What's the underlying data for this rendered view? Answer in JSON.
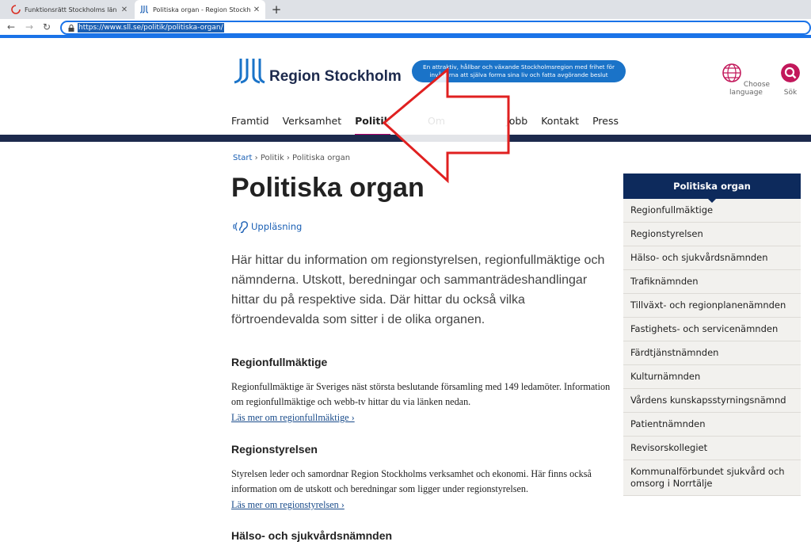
{
  "browser": {
    "tabs": [
      {
        "title": "Funktionsrätt Stockholms län – Et"
      },
      {
        "title": "Politiska organ - Region Stockholm"
      }
    ],
    "new_tab_label": "+",
    "url": "https://www.sll.se/politik/politiska-organ/"
  },
  "header": {
    "logo_text": "Region Stockholm",
    "tagline": "En attraktiv, hållbar och växande Stockholmsregion med frihet för invånarna att själva forma sina liv och fatta avgörande beslut",
    "language_label": "Choose language",
    "search_label": "Sök"
  },
  "nav": {
    "items": [
      {
        "label": "Framtid"
      },
      {
        "label": "Verksamhet"
      },
      {
        "label": "Politik"
      },
      {
        "label": "Om"
      },
      {
        "label": "Jobb"
      },
      {
        "label": "Kontakt"
      },
      {
        "label": "Press"
      }
    ]
  },
  "breadcrumb": {
    "items": [
      "Start",
      "Politik",
      "Politiska organ"
    ],
    "separator": "›"
  },
  "page": {
    "title": "Politiska organ",
    "listen_label": "Uppläsning",
    "intro": "Här hittar du information om regionstyrelsen, regionfullmäktige och nämnderna. Utskott, beredningar och sammanträdeshandlingar hittar du på respektive sida. Där hittar du också vilka förtroendevalda som sitter i de olika organen.",
    "sections": [
      {
        "heading": "Regionfullmäktige",
        "body": "Regionfullmäktige är Sveriges näst största beslutande församling med 149 ledamöter. Information om regionfullmäktige och webb-tv hittar du via länken nedan.",
        "link": "Läs mer om regionfullmäktige ›"
      },
      {
        "heading": "Regionstyrelsen",
        "body": "Styrelsen leder och samordnar Region Stockholms verksamhet och ekonomi. Här finns också information om de utskott och beredningar som ligger under regionstyrelsen.",
        "link": "Läs mer om regionstyrelsen ›"
      },
      {
        "heading": "Hälso- och sjukvårdsnämnden"
      }
    ]
  },
  "sidebar": {
    "title": "Politiska organ",
    "items": [
      "Regionfullmäktige",
      "Regionstyrelsen",
      "Hälso- och sjukvårdsnämnden",
      "Trafiknämnden",
      "Tillväxt- och regionplanenämnden",
      "Fastighets- och servicenämnden",
      "Färdtjänstnämnden",
      "Kulturnämnden",
      "Vårdens kunskapsstyrningsnämnd",
      "Patientnämnden",
      "Revisorskollegiet",
      "Kommunalförbundet sjukvård och omsorg i Norrtälje"
    ]
  },
  "colors": {
    "navy": "#1d2a4d",
    "accent_magenta": "#b5006e",
    "link_blue": "#1a5fb4",
    "annotation_red": "#e02020"
  }
}
